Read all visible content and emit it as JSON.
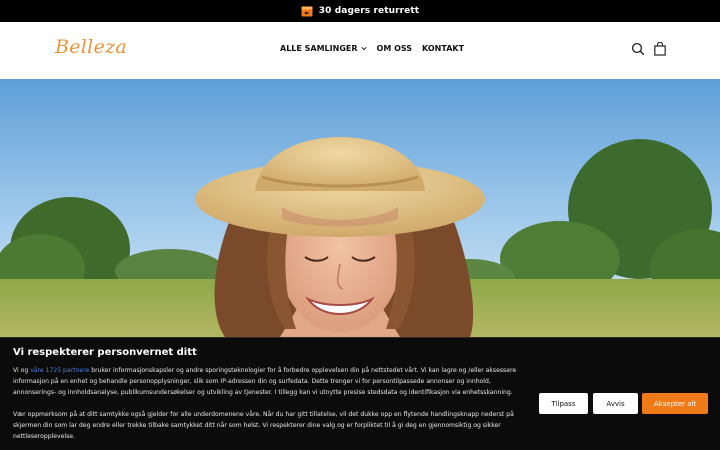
{
  "announcement": {
    "text": "30 dagers returrett",
    "icon": "box-return-icon"
  },
  "header": {
    "logo": "Belleza",
    "nav": [
      {
        "label": "ALLE SAMLINGER",
        "has_dropdown": true
      },
      {
        "label": "OM OSS"
      },
      {
        "label": "KONTAKT"
      }
    ],
    "icons": [
      "search-icon",
      "bag-icon"
    ]
  },
  "hero": {
    "image": "smiling woman in straw hat in sunny meadow"
  },
  "cookie": {
    "title": "Vi respekterer personvernet ditt",
    "p1_pre": "Vi og ",
    "p1_link": "våre 1725 partnere",
    "p1_post": " bruker informasjonskapsler og andre sporingsteknologier for å forbedre opplevelsen din på nettstedet vårt. Vi kan lagre og /eller aksessere informasjon på en enhet og behandle personopplysninger, slik som IP-adressen din og surfedata. Dette trenger vi for persontilpassede annonser og innhold, annonserings- og innholdsanalyse, publikumsundersøkelser og utvikling av tjenester. I tillegg kan vi utnytte presise stedsdata og identifikasjon via enhetsskanning.",
    "p2": "Vær oppmerksom på at ditt samtykke også gjelder for alle underdomenene våre. Når du har gitt tillatelse, vil det dukke opp en flytende handlingsknapp nederst på skjermen din som lar deg endre eller trekke tilbake samtykket ditt når som helst. Vi respekterer dine valg og er forpliktet til å gi deg en gjennomsiktig og sikker nettleseropplevelse.",
    "buttons": {
      "customize": "Tilpass",
      "reject": "Avvis",
      "accept": "Aksepter alt"
    }
  },
  "colors": {
    "accent": "#f07a18",
    "logo": "#e8943a",
    "link": "#4f7fd9"
  }
}
